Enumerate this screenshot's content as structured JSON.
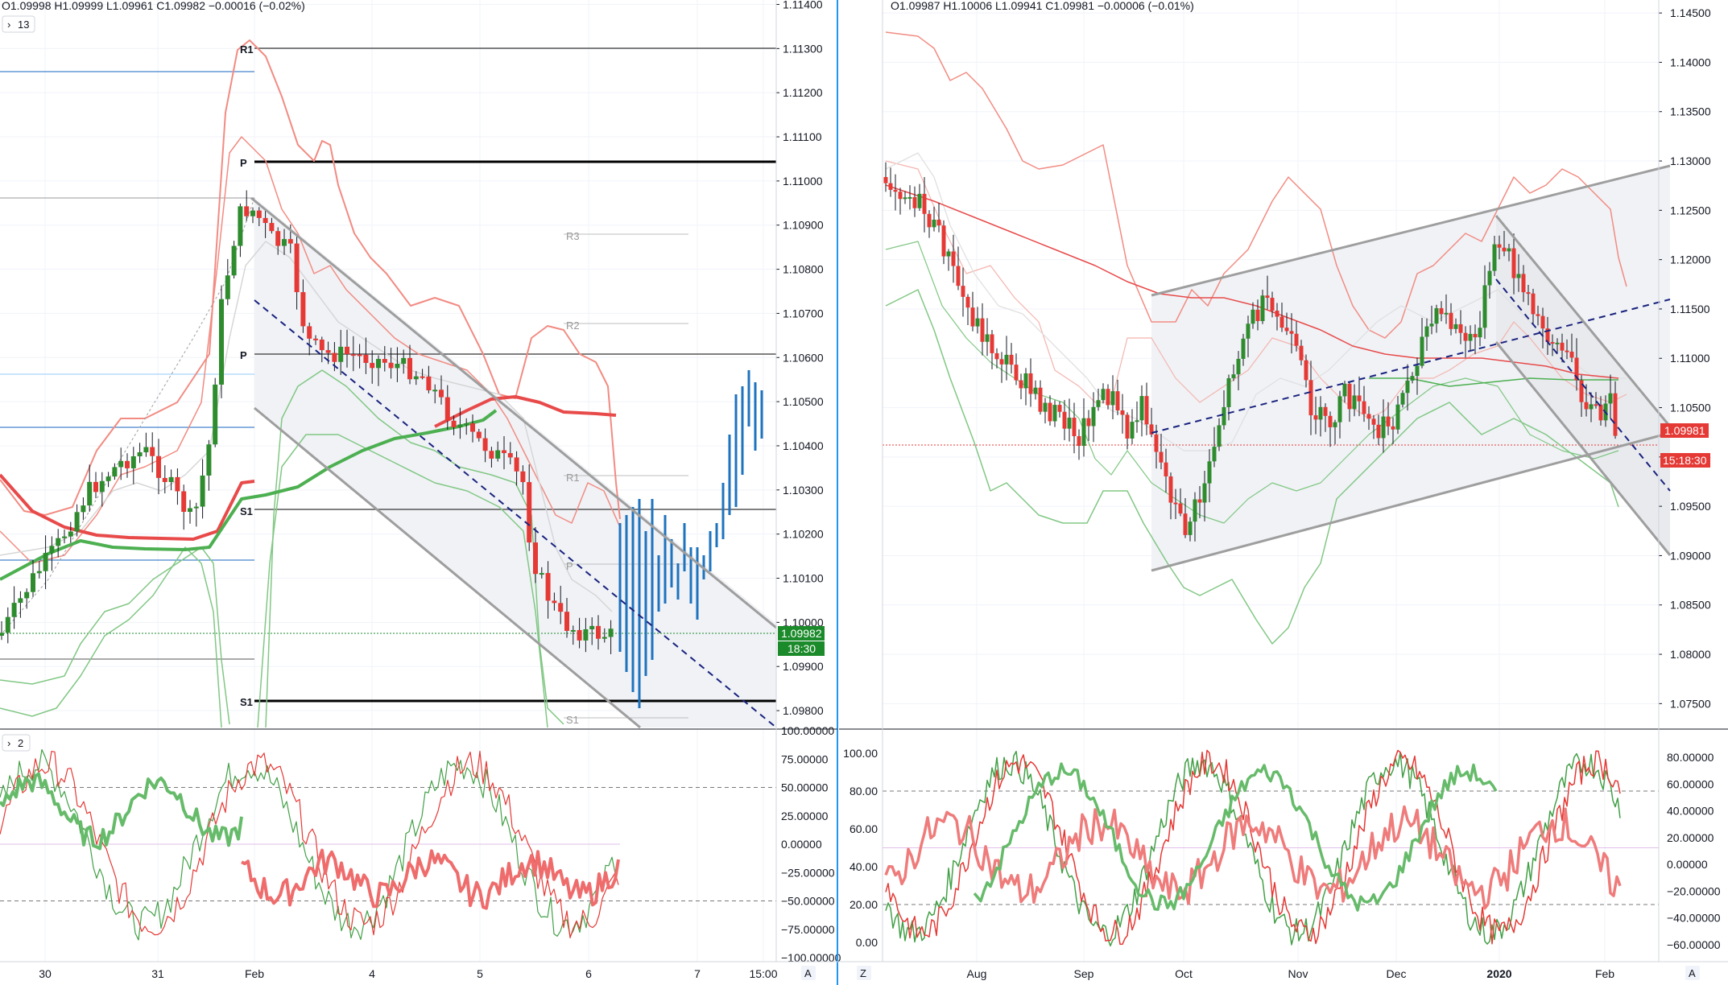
{
  "colors": {
    "up": "#2e8b2e",
    "down": "#e53935",
    "blue": "#1565c0",
    "grid": "#f0f3fa",
    "maRed": "#e84a4a",
    "maGreen": "#4caf50",
    "bandRed": "#f28b82",
    "bandGreen": "#81c784",
    "channel": "#9e9e9e",
    "dash": "#1a237e",
    "priceGreen": "#1b8a2a",
    "priceRed": "#e53935"
  },
  "left": {
    "ohlc": "O1.09998  H1.09999  L1.09961  C1.09982  −0.00016 (−0.02%)",
    "pane_btn": "13",
    "osc_btn": "2",
    "price_label": "1.09982",
    "countdown": "18:30",
    "pivot_labels": {
      "r1": "R1",
      "p_top": "P",
      "p_mid": "P",
      "s1_mid": "S1",
      "s1_low": "S1",
      "r3": "R3",
      "r2": "R2",
      "r1b": "R1",
      "pb": "P",
      "s1b": "S1"
    },
    "footer_btn": "A",
    "x_ticks": [
      "30",
      "31",
      "Feb",
      "4",
      "5",
      "6",
      "7",
      "15:00"
    ],
    "y_ticks": [
      "1.11400",
      "1.11300",
      "1.11200",
      "1.11100",
      "1.11000",
      "1.10900",
      "1.10800",
      "1.10700",
      "1.10600",
      "1.10500",
      "1.10400",
      "1.10300",
      "1.10200",
      "1.10100",
      "1.10000",
      "1.09900",
      "1.09800"
    ],
    "osc_ticks": [
      "100.00000",
      "75.00000",
      "50.00000",
      "25.00000",
      "0.00000",
      "−25.00000",
      "−50.00000",
      "−75.00000",
      "−100.00000"
    ]
  },
  "right": {
    "ohlc": "O1.09987  H1.10006  L1.09941  C1.09981  −0.00006 (−0.01%)",
    "price_label": "1.09981",
    "countdown": "15:18:30",
    "footer_left_btn": "Z",
    "footer_right_btn": "A",
    "x_ticks": [
      "Aug",
      "Sep",
      "Oct",
      "Nov",
      "Dec",
      "2020",
      "Feb"
    ],
    "y_ticks": [
      "1.14500",
      "1.14000",
      "1.13500",
      "1.13000",
      "1.12500",
      "1.12000",
      "1.11500",
      "1.11000",
      "1.10500",
      "1.10000",
      "1.09500",
      "1.09000",
      "1.08500",
      "1.08000",
      "1.07500"
    ],
    "osc_left_ticks": [
      "100.00",
      "80.00",
      "60.00",
      "40.00",
      "20.00",
      "0.00"
    ],
    "osc_right_ticks": [
      "80.00000",
      "60.00000",
      "40.00000",
      "20.00000",
      "0.00000",
      "−20.00000",
      "−40.00000",
      "−60.00000"
    ]
  },
  "chart_data": [
    {
      "type": "candlestick",
      "title": "",
      "symbol": "",
      "timeframe": "",
      "last_price": 1.09982,
      "open": 1.09998,
      "high": 1.09999,
      "low": 1.09961,
      "close": 1.09982,
      "change": -0.00016,
      "change_pct": -0.02,
      "ylim": [
        1.0976,
        1.1141
      ],
      "x_categories": [
        "30",
        "31",
        "Feb",
        "4",
        "5",
        "6",
        "7",
        "15:00"
      ],
      "pivots": {
        "R1": 1.1129,
        "P": 1.1104,
        "S1": 1.0983
      },
      "indicators": [
        "Bollinger Bands",
        "Moving Averages",
        "Pivot Points",
        "Regression Channel"
      ],
      "oscillator": {
        "ylim": [
          -100,
          100
        ],
        "levels": [
          50,
          0,
          -50
        ]
      }
    },
    {
      "type": "candlestick",
      "title": "",
      "symbol": "",
      "timeframe": "",
      "last_price": 1.09981,
      "open": 1.09987,
      "high": 1.10006,
      "low": 1.09941,
      "close": 1.09981,
      "change": -6e-05,
      "change_pct": -0.01,
      "ylim": [
        1.0725,
        1.1455
      ],
      "x_categories": [
        "Aug",
        "Sep",
        "Oct",
        "Nov",
        "Dec",
        "2020",
        "Feb"
      ],
      "indicators": [
        "Bollinger Bands",
        "Moving Averages",
        "Regression Channel"
      ],
      "oscillator": {
        "ylim_left": [
          0,
          100
        ],
        "ylim_right": [
          -60,
          80
        ],
        "levels": [
          80,
          50,
          20
        ]
      }
    }
  ]
}
